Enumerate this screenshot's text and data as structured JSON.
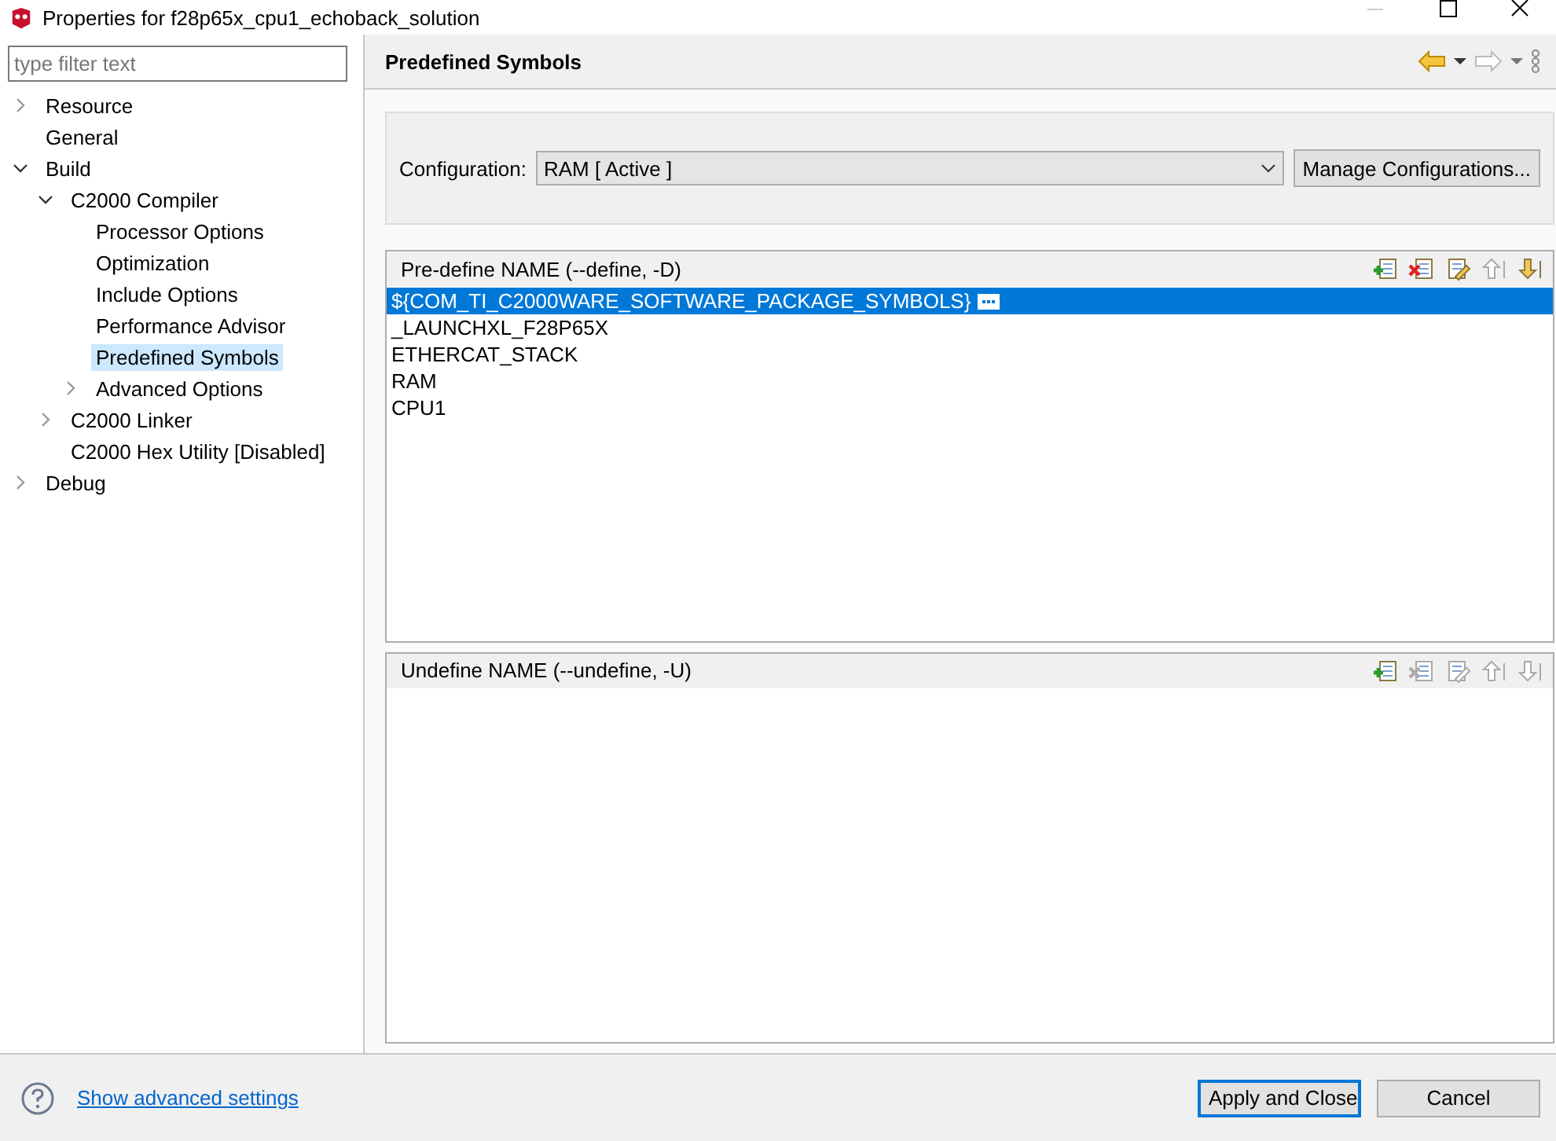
{
  "window": {
    "title": "Properties for f28p65x_cpu1_echoback_solution"
  },
  "filter": {
    "placeholder": "type filter text"
  },
  "tree": [
    {
      "label": "Resource",
      "expanded": false,
      "selected": false
    },
    {
      "label": "General",
      "selected": false
    },
    {
      "label": "Build",
      "expanded": true,
      "selected": false,
      "children": [
        {
          "label": "C2000 Compiler",
          "expanded": true,
          "selected": false,
          "children": [
            {
              "label": "Processor Options",
              "selected": false
            },
            {
              "label": "Optimization",
              "selected": false
            },
            {
              "label": "Include Options",
              "selected": false
            },
            {
              "label": "Performance Advisor",
              "selected": false
            },
            {
              "label": "Predefined Symbols",
              "selected": true
            },
            {
              "label": "Advanced Options",
              "expanded": false,
              "selected": false
            }
          ]
        },
        {
          "label": "C2000 Linker",
          "expanded": false,
          "selected": false
        },
        {
          "label": "C2000 Hex Utility  [Disabled]",
          "selected": false
        }
      ]
    },
    {
      "label": "Debug",
      "expanded": false,
      "selected": false
    }
  ],
  "page": {
    "title": "Predefined Symbols"
  },
  "configuration": {
    "label": "Configuration:",
    "value": "RAM  [ Active ]",
    "button": "Manage Configurations..."
  },
  "panels": [
    {
      "title": "Pre-define NAME (--define, -D)",
      "tools": [
        {
          "kind": "add",
          "enabled": true
        },
        {
          "kind": "delete",
          "enabled": true
        },
        {
          "kind": "edit",
          "enabled": true
        },
        {
          "kind": "up",
          "enabled": false
        },
        {
          "kind": "down",
          "enabled": true
        }
      ],
      "items": [
        {
          "text": "${COM_TI_C2000WARE_SOFTWARE_PACKAGE_SYMBOLS}",
          "selected": true,
          "more": true
        },
        {
          "text": "_LAUNCHXL_F28P65X",
          "selected": false,
          "more": false
        },
        {
          "text": "ETHERCAT_STACK",
          "selected": false,
          "more": false
        },
        {
          "text": "RAM",
          "selected": false,
          "more": false
        },
        {
          "text": "CPU1",
          "selected": false,
          "more": false
        }
      ]
    },
    {
      "title": "Undefine NAME (--undefine, -U)",
      "tools": [
        {
          "kind": "add",
          "enabled": true
        },
        {
          "kind": "delete",
          "enabled": false
        },
        {
          "kind": "edit",
          "enabled": false
        },
        {
          "kind": "up",
          "enabled": false
        },
        {
          "kind": "down",
          "enabled": false
        }
      ]
    }
  ],
  "footer": {
    "link": "Show advanced settings",
    "buttons": [
      {
        "label": "Apply and Close",
        "default": true
      },
      {
        "label": "Cancel",
        "default": false
      }
    ]
  }
}
